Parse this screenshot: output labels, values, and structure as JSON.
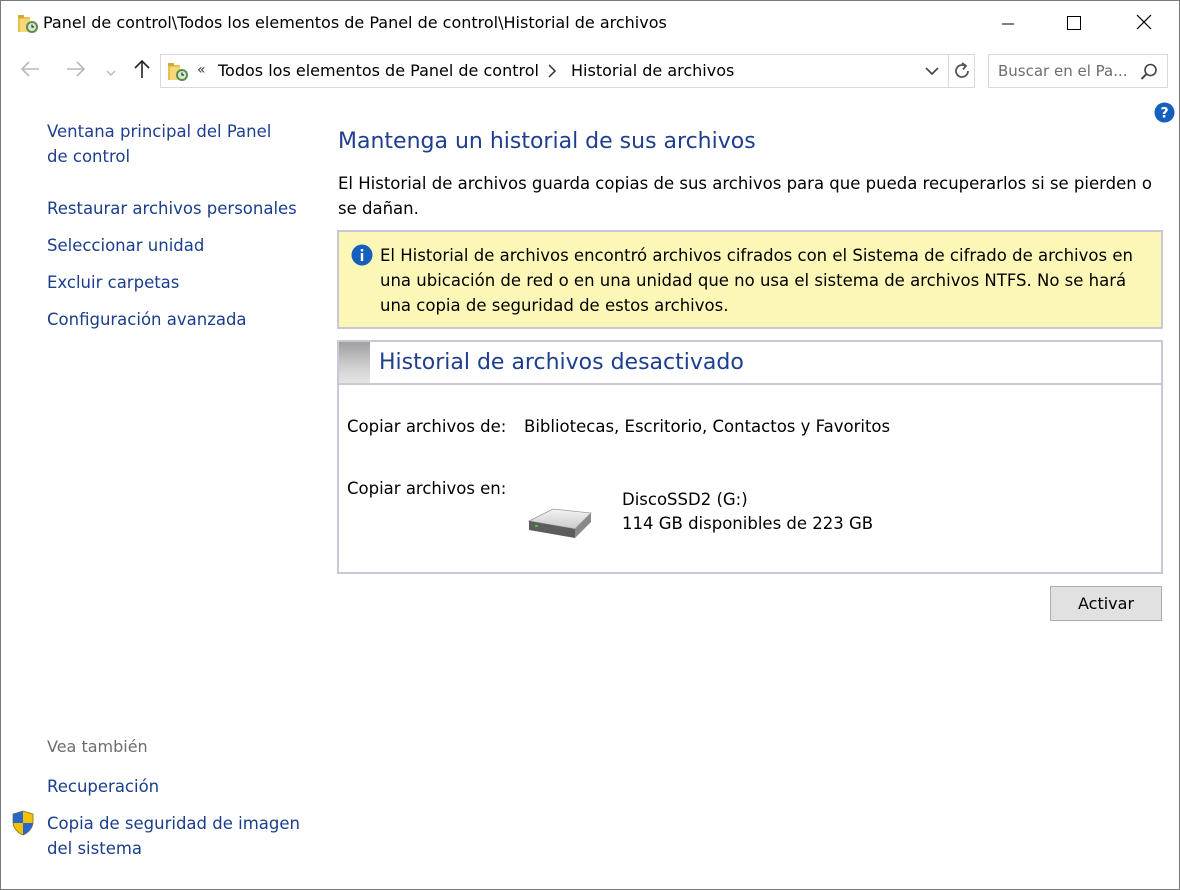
{
  "window": {
    "title": "Panel de control\\Todos los elementos de Panel de control\\Historial de archivos"
  },
  "address": {
    "overflow_chevron": "«",
    "crumb1": "Todos los elementos de Panel de control",
    "crumb2": "Historial de archivos"
  },
  "search": {
    "placeholder": "Buscar en el Pa..."
  },
  "sidebar": {
    "main_link": "Ventana principal del Panel de control",
    "links": [
      "Restaurar archivos personales",
      "Seleccionar unidad",
      "Excluir carpetas",
      "Configuración avanzada"
    ],
    "see_also_label": "Vea también",
    "see_also_links": [
      "Recuperación",
      "Copia de seguridad de imagen del sistema"
    ]
  },
  "main": {
    "heading": "Mantenga un historial de sus archivos",
    "description": "El Historial de archivos guarda copias de sus archivos para que pueda recuperarlos si se pierden o se dañan.",
    "info_message": "El Historial de archivos encontró archivos cifrados con el Sistema de cifrado de archivos en una ubicación de red o en una unidad que no usa el sistema de archivos NTFS. No se hará una copia de seguridad de estos archivos.",
    "status_title": "Historial de archivos desactivado",
    "copy_from_label": "Copiar archivos de:",
    "copy_from_value": "Bibliotecas, Escritorio, Contactos y Favoritos",
    "copy_to_label": "Copiar archivos en:",
    "drive_name": "DiscoSSD2 (G:)",
    "drive_space": "114 GB disponibles de 223 GB",
    "activate_button": "Activar"
  },
  "colors": {
    "link": "#1a3e8c",
    "heading": "#1e3e8f",
    "info_bg": "#fcf7b6",
    "border": "#c8c8d8"
  },
  "icons": [
    "folder-history-icon",
    "minimize-icon",
    "maximize-icon",
    "close-icon",
    "back-arrow-icon",
    "forward-arrow-icon",
    "recent-locations-icon",
    "up-arrow-icon",
    "breadcrumb-separator-icon",
    "address-dropdown-icon",
    "refresh-icon",
    "search-icon",
    "help-icon",
    "info-icon",
    "hard-drive-icon",
    "uac-shield-icon"
  ]
}
